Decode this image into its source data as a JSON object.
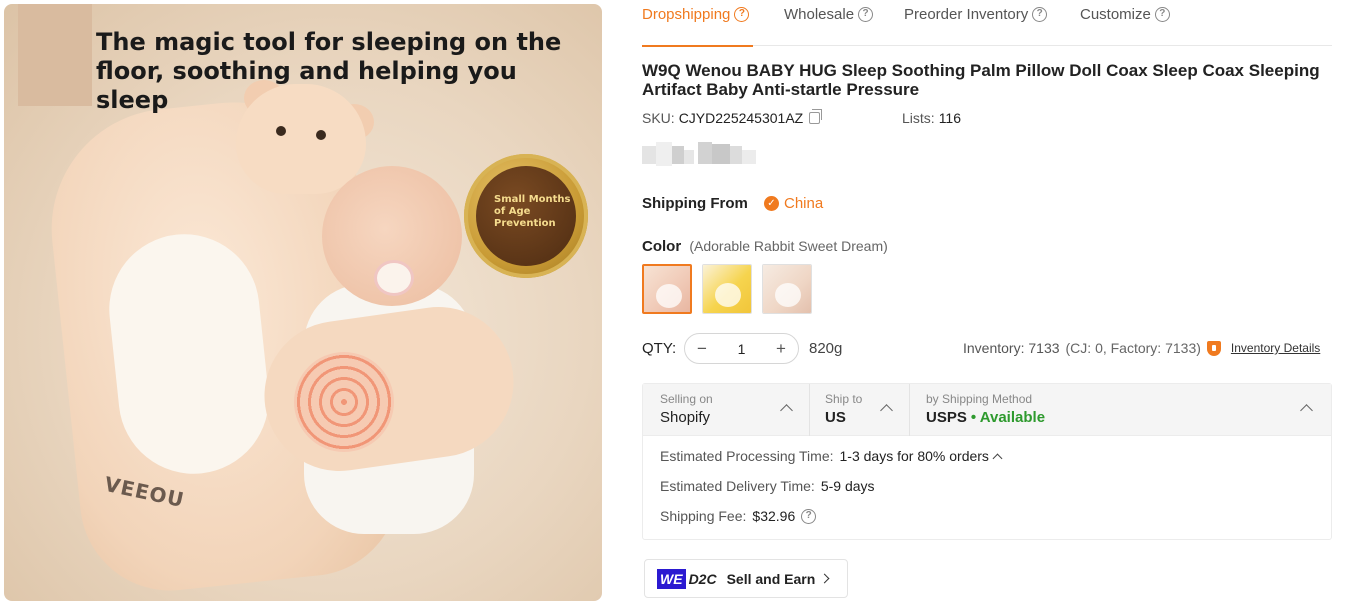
{
  "hero": {
    "headline": "The magic tool for sleeping on the\nfloor, soothing and helping you sleep",
    "badge_text": "Small Months\nof Age\nPrevention",
    "brand_mark": "VEEOU"
  },
  "tabs": [
    {
      "label": "Dropshipping",
      "active": true
    },
    {
      "label": "Wholesale",
      "active": false
    },
    {
      "label": "Preorder Inventory",
      "active": false
    },
    {
      "label": "Customize",
      "active": false
    }
  ],
  "product": {
    "title": "W9Q Wenou BABY HUG Sleep Soothing Palm Pillow Doll Coax Sleep Coax Sleeping Artifact Baby Anti-startle Pressure",
    "sku_label": "SKU:",
    "sku": "CJYD225245301AZ",
    "lists_label": "Lists:",
    "lists": "116"
  },
  "shipping_from": {
    "label": "Shipping From",
    "origin": "China"
  },
  "color": {
    "label": "Color",
    "selected_name": "(Adorable Rabbit Sweet Dream)",
    "swatches": [
      {
        "name": "Adorable Rabbit Sweet Dream",
        "selected": true
      },
      {
        "name": "yellow variant",
        "selected": false
      },
      {
        "name": "beige variant",
        "selected": false
      }
    ]
  },
  "quantity": {
    "label": "QTY:",
    "value": "1",
    "minus": "−",
    "plus": "+",
    "weight": "820g"
  },
  "inventory": {
    "label": "Inventory: 7133",
    "breakdown": "(CJ: 0, Factory: 7133)",
    "details_link": "Inventory Details"
  },
  "shipping_card": {
    "selling_on_label": "Selling on",
    "selling_on_value": "Shopify",
    "ship_to_label": "Ship to",
    "ship_to_value": "US",
    "method_label": "by Shipping Method",
    "method_value": "USPS",
    "method_status": "• Available",
    "processing_label": "Estimated Processing Time:",
    "processing_value": "1-3 days for 80% orders",
    "delivery_label": "Estimated Delivery Time:",
    "delivery_value": "5-9 days",
    "fee_label": "Shipping Fee:",
    "fee_value": "$32.96"
  },
  "promo": {
    "we_logo": "WE",
    "d2c_logo": "D2C",
    "text": "Sell and Earn"
  },
  "colors": {
    "accent": "#f07a1f",
    "available_green": "#2e9a2e",
    "we_blue": "#2b1ad1"
  }
}
